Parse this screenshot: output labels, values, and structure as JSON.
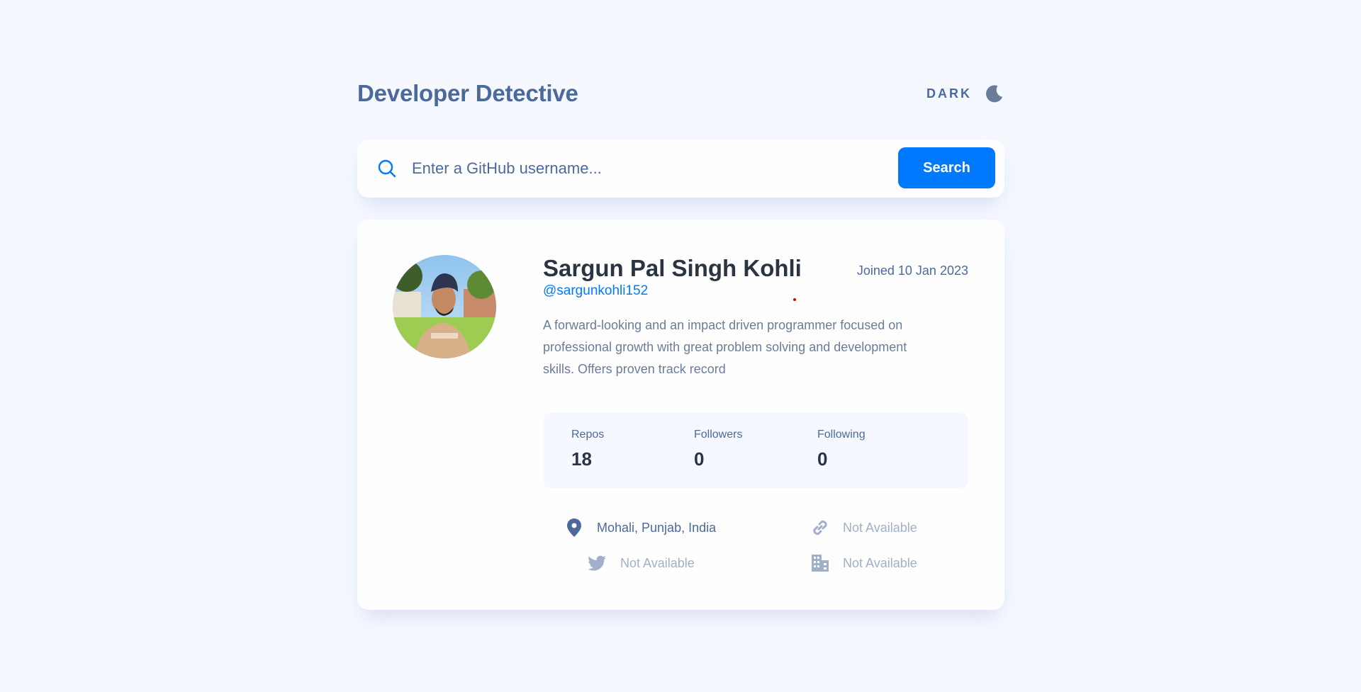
{
  "header": {
    "title": "Developer Detective",
    "theme_label": "DARK",
    "theme_icon": "moon-icon"
  },
  "search": {
    "placeholder": "Enter a GitHub username...",
    "value": "",
    "button_label": "Search",
    "icon": "search-icon"
  },
  "profile": {
    "avatar_icon": "avatar",
    "name": "Sargun Pal Singh Kohli",
    "login": "@sargunkohli152",
    "joined": "Joined 10 Jan 2023",
    "bio": "A forward-looking and an impact driven programmer focused on professional growth with great problem solving and development skills. Offers proven track record",
    "stats": {
      "repos_label": "Repos",
      "repos": "18",
      "followers_label": "Followers",
      "followers": "0",
      "following_label": "Following",
      "following": "0"
    },
    "links": {
      "location": "Mohali, Punjab, India",
      "website": "Not Available",
      "twitter": "Not Available",
      "company": "Not Available"
    }
  },
  "colors": {
    "accent": "#0079ff",
    "text_primary": "#2b3442",
    "text_secondary": "#4b6a9b",
    "background": "#f5f8ff",
    "card": "#fefefe"
  }
}
